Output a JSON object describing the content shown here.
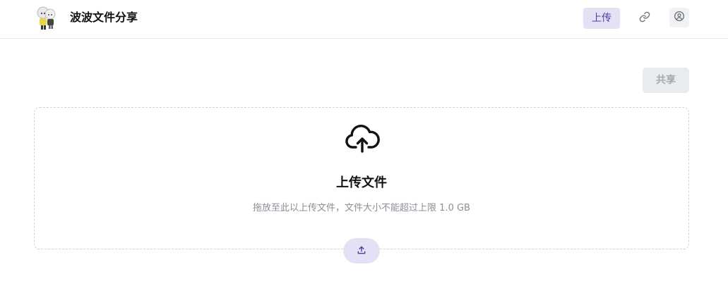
{
  "header": {
    "title": "波波文件分享",
    "upload_label": "上传"
  },
  "actions": {
    "share_label": "共享"
  },
  "dropzone": {
    "title": "上传文件",
    "hint": "拖放至此以上传文件，文件大小不能超过上限 1.0 GB"
  },
  "icons": {
    "logo": "app-logo",
    "nav_link": "link-icon",
    "nav_user": "user-circle-icon",
    "cloud": "cloud-upload-icon",
    "fab": "upload-arrow-icon"
  },
  "colors": {
    "accent": "#4b3fa8",
    "accent_bg": "#e4e1f5",
    "disabled_bg": "#e9ecef",
    "disabled_text": "#a5aab1",
    "muted_text": "#8a8f97",
    "border": "#cfd2d6"
  }
}
